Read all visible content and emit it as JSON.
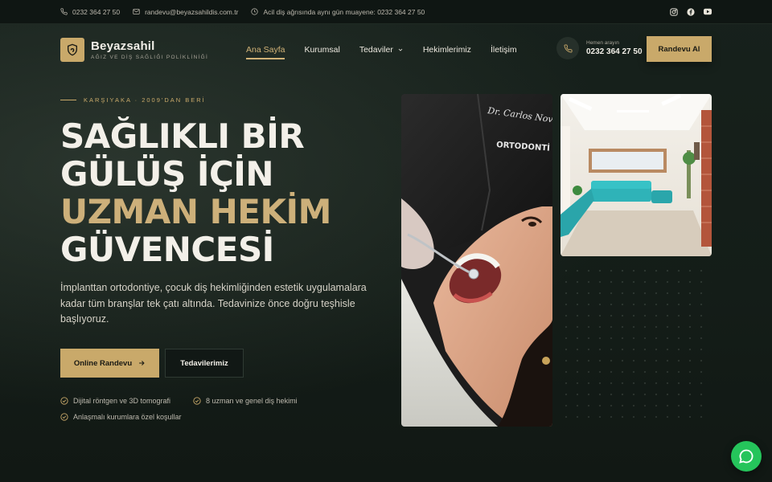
{
  "topbar": {
    "phone": "0232 364 27 50",
    "email": "randevu@beyazsahildis.com.tr",
    "hours": "Acil diş ağrısında aynı gün muayene: 0232 364 27 50",
    "socials": [
      "instagram-icon",
      "facebook-icon",
      "youtube-icon"
    ]
  },
  "header": {
    "brand": "Beyazsahil",
    "tagline": "AĞIZ VE DİŞ SAĞLIĞI POLİKLİNİĞİ",
    "nav": [
      "Ana Sayfa",
      "Kurumsal",
      "Tedaviler",
      "Hekimlerimiz",
      "İletişim"
    ],
    "active_nav": "Ana Sayfa",
    "phone_label": "Hemen arayın",
    "phone_number": "0232 364 27 50",
    "cta": "Randevu Al"
  },
  "hero": {
    "eyebrow": "KARŞIYAKA · 2009'DAN BERİ",
    "headline_1": "SAĞLIKLI BİR",
    "headline_2": "GÜLÜŞ İÇİN",
    "headline_3": "UZMAN HEKİM",
    "headline_4": "GÜVENCESİ",
    "lead": "İmplanttan ortodontiye, çocuk diş hekimliğinden estetik uygulamalara kadar tüm branşlar tek çatı altında. Tedavinize önce doğru teşhisle başlıyoruz.",
    "btn_primary": "Online Randevu",
    "btn_secondary": "Tedavilerimiz",
    "features": [
      "Dijital röntgen ve 3D tomografi",
      "8 uzman ve genel diş hekimi",
      "Anlaşmalı kurumlara özel koşullar"
    ]
  },
  "images": {
    "main_coat_name": "Dr. Carlos Novan",
    "main_coat_dept": "ORTODONTİ"
  },
  "colors": {
    "gold": "#c9a96a",
    "background": "#121a16",
    "chat": "#25c45b"
  }
}
